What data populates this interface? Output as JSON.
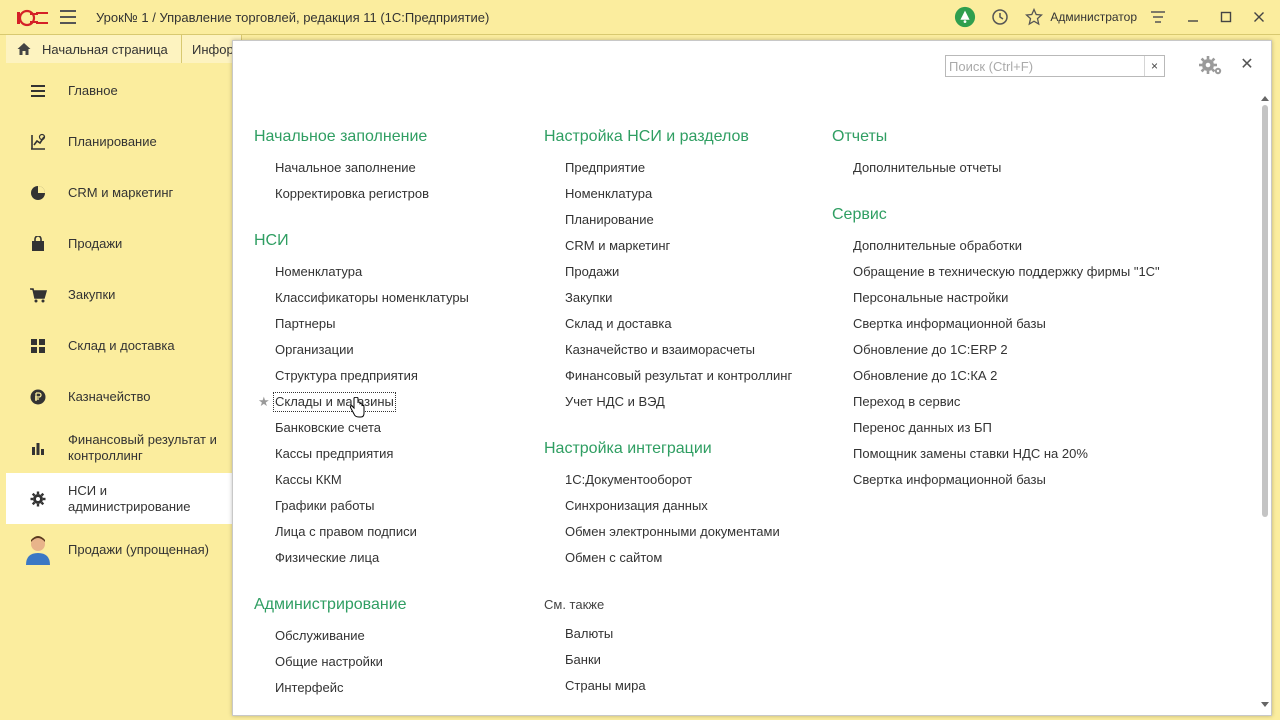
{
  "window": {
    "title": "Урок№ 1 / Управление торговлей, редакция 11  (1С:Предприятие)",
    "user": "Администратор"
  },
  "tabs": [
    {
      "label": "Начальная страница"
    },
    {
      "label": "Инфор"
    }
  ],
  "sidebar": {
    "items": [
      {
        "label": "Главное",
        "icon": "list-icon"
      },
      {
        "label": "Планирование",
        "icon": "planning-icon"
      },
      {
        "label": "CRM и маркетинг",
        "icon": "pie-chart-icon"
      },
      {
        "label": "Продажи",
        "icon": "shopping-bag-icon"
      },
      {
        "label": "Закупки",
        "icon": "cart-icon"
      },
      {
        "label": "Склад и доставка",
        "icon": "warehouse-icon"
      },
      {
        "label": "Казначейство",
        "icon": "ruble-coin-icon"
      },
      {
        "label": "Финансовый результат и контроллинг",
        "icon": "bar-chart-icon"
      },
      {
        "label": "НСИ и администрирование",
        "icon": "gear-icon",
        "active": true
      },
      {
        "label": "Продажи (упрощенная)",
        "icon": "person-icon"
      }
    ]
  },
  "panel": {
    "search": {
      "placeholder": "Поиск (Ctrl+F)",
      "value": ""
    },
    "columns": [
      {
        "sections": [
          {
            "title": "Начальное заполнение",
            "items": [
              "Начальное заполнение",
              "Корректировка регистров"
            ]
          },
          {
            "title": "НСИ",
            "items": [
              "Номенклатура",
              "Классификаторы номенклатуры",
              "Партнеры",
              "Организации",
              "Структура предприятия",
              "Склады и магазины",
              "Банковские счета",
              "Кассы предприятия",
              "Кассы ККМ",
              "Графики работы",
              "Лица с правом подписи",
              "Физические лица"
            ]
          },
          {
            "title": "Администрирование",
            "items": [
              "Обслуживание",
              "Общие настройки",
              "Интерфейс"
            ]
          }
        ]
      },
      {
        "sections": [
          {
            "title": "Настройка НСИ и разделов",
            "items": [
              "Предприятие",
              "Номенклатура",
              "Планирование",
              "CRM и маркетинг",
              "Продажи",
              "Закупки",
              "Склад и доставка",
              "Казначейство и взаиморасчеты",
              "Финансовый результат и контроллинг",
              "Учет НДС и ВЭД"
            ]
          },
          {
            "title": "Настройка интеграции",
            "items": [
              "1С:Документооборот",
              "Синхронизация данных",
              "Обмен электронными документами",
              "Обмен с сайтом"
            ]
          }
        ],
        "see_also": {
          "title": "См. также",
          "items": [
            "Валюты",
            "Банки",
            "Страны мира"
          ]
        }
      },
      {
        "sections": [
          {
            "title": "Отчеты",
            "items": [
              "Дополнительные отчеты"
            ]
          },
          {
            "title": "Сервис",
            "items": [
              "Дополнительные обработки",
              "Обращение в техническую поддержку фирмы \"1С\"",
              "Персональные настройки",
              "Свертка информационной базы",
              "Обновление до 1С:ERP 2",
              "Обновление до 1С:КА 2",
              "Переход в сервис",
              "Перенос данных из БП",
              "Помощник замены ставки НДС на 20%",
              "Свертка информационной базы"
            ]
          }
        ]
      }
    ]
  },
  "colors": {
    "accent_green": "#2f9e62",
    "sidebar_bg": "#fbed9e",
    "active_bg": "#ffffff"
  }
}
